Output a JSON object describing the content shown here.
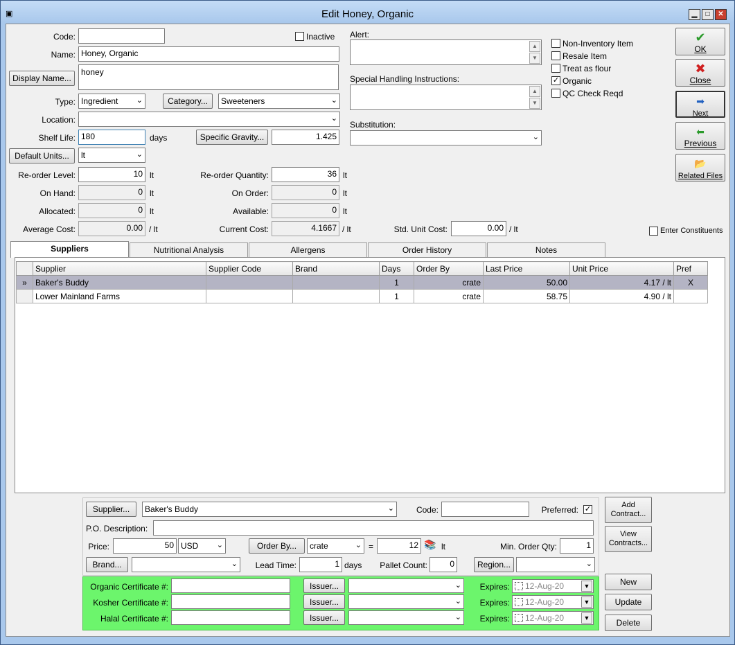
{
  "window": {
    "title": "Edit Honey, Organic"
  },
  "form": {
    "code_label": "Code:",
    "code_value": "",
    "inactive_label": "Inactive",
    "name_label": "Name:",
    "name_value": "Honey, Organic",
    "display_name_button": "Display Name...",
    "display_name_value": "honey",
    "type_label": "Type:",
    "type_value": "Ingredient",
    "category_button": "Category...",
    "category_value": "Sweeteners",
    "location_label": "Location:",
    "location_value": "",
    "shelf_life_label": "Shelf Life:",
    "shelf_life_value": "180",
    "shelf_life_unit": "days",
    "specific_gravity_button": "Specific Gravity...",
    "specific_gravity_value": "1.425",
    "default_units_button": "Default Units...",
    "default_units_value": "lt",
    "reorder_level_label": "Re-order Level:",
    "reorder_level_value": "10",
    "reorder_level_unit": "lt",
    "reorder_qty_label": "Re-order Quantity:",
    "reorder_qty_value": "36",
    "reorder_qty_unit": "lt",
    "on_hand_label": "On Hand:",
    "on_hand_value": "0",
    "on_hand_unit": "lt",
    "on_order_label": "On Order:",
    "on_order_value": "0",
    "on_order_unit": "lt",
    "allocated_label": "Allocated:",
    "allocated_value": "0",
    "allocated_unit": "lt",
    "available_label": "Available:",
    "available_value": "0",
    "available_unit": "lt",
    "avg_cost_label": "Average Cost:",
    "avg_cost_value": "0.00",
    "avg_cost_unit": "/ lt",
    "current_cost_label": "Current Cost:",
    "current_cost_value": "4.1667",
    "current_cost_unit": "/ lt",
    "std_unit_cost_label": "Std. Unit Cost:",
    "std_unit_cost_value": "0.00",
    "std_unit_cost_unit": "/ lt",
    "alert_label": "Alert:",
    "special_handling_label": "Special Handling Instructions:",
    "substitution_label": "Substitution:",
    "substitution_value": "",
    "enter_constituents_label": "Enter Constituents"
  },
  "flags": [
    {
      "label": "Non-Inventory Item",
      "checked": false
    },
    {
      "label": "Resale Item",
      "checked": false
    },
    {
      "label": "Treat as flour",
      "checked": false
    },
    {
      "label": "Organic",
      "checked": true
    },
    {
      "label": "QC Check Reqd",
      "checked": false
    }
  ],
  "side_buttons": {
    "ok": "OK",
    "close": "Close",
    "next": "Next",
    "previous": "Previous",
    "related_files": "Related Files"
  },
  "tabs": [
    "Suppliers",
    "Nutritional Analysis",
    "Allergens",
    "Order History",
    "Notes"
  ],
  "grid": {
    "columns": [
      "Supplier",
      "Supplier Code",
      "Brand",
      "Days",
      "Order By",
      "Last Price",
      "Unit Price",
      "Pref"
    ],
    "rows": [
      {
        "marker": "»",
        "supplier": "Baker's Buddy",
        "supplier_code": "",
        "brand": "",
        "days": "1",
        "order_by": "crate",
        "last_price": "50.00",
        "unit_price": "4.17 / lt",
        "pref": "X"
      },
      {
        "marker": "",
        "supplier": "Lower Mainland Farms",
        "supplier_code": "",
        "brand": "",
        "days": "1",
        "order_by": "crate",
        "last_price": "58.75",
        "unit_price": "4.90 / lt",
        "pref": ""
      }
    ]
  },
  "detail": {
    "supplier_button": "Supplier...",
    "supplier_value": "Baker's Buddy",
    "code_label": "Code:",
    "code_value": "",
    "preferred_label": "Preferred:",
    "po_desc_label": "P.O. Description:",
    "po_desc_value": "",
    "price_label": "Price:",
    "price_value": "50",
    "currency_value": "USD",
    "order_by_button": "Order By...",
    "order_by_value": "crate",
    "equals": "=",
    "order_qty_value": "12",
    "order_qty_unit": "lt",
    "min_order_label": "Min. Order Qty:",
    "min_order_value": "1",
    "brand_button": "Brand...",
    "brand_value": "",
    "lead_time_label": "Lead Time:",
    "lead_time_value": "1",
    "lead_time_unit": "days",
    "pallet_label": "Pallet Count:",
    "pallet_value": "0",
    "region_button": "Region...",
    "region_value": ""
  },
  "certs": [
    {
      "label": "Organic Certificate #:",
      "value": "",
      "issuer_button": "Issuer...",
      "issuer_value": "",
      "expires_label": "Expires:",
      "expires_value": "12-Aug-20"
    },
    {
      "label": "Kosher Certificate #:",
      "value": "",
      "issuer_button": "Issuer...",
      "issuer_value": "",
      "expires_label": "Expires:",
      "expires_value": "12-Aug-20"
    },
    {
      "label": "Halal Certificate #:",
      "value": "",
      "issuer_button": "Issuer...",
      "issuer_value": "",
      "expires_label": "Expires:",
      "expires_value": "12-Aug-20"
    }
  ],
  "actions": {
    "add_contract": "Add Contract...",
    "view_contracts": "View Contracts...",
    "new": "New",
    "update": "Update",
    "delete": "Delete"
  }
}
